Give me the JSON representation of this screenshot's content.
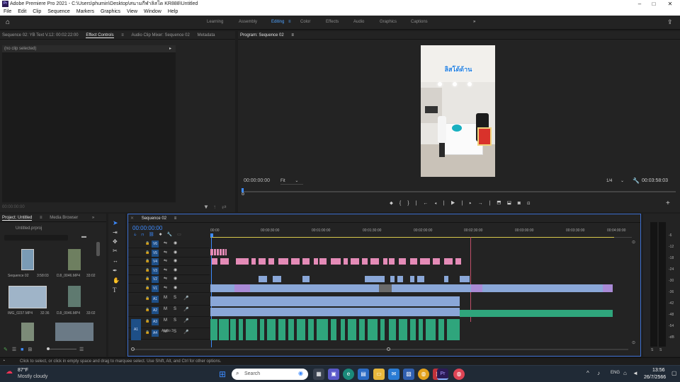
{
  "window": {
    "title": "Adobe Premiere Pro 2021 - C:\\Users\\phumin\\Desktop\\สนามกีฬาลิสโด KR888\\Untitled",
    "logo": "Pr"
  },
  "menu": [
    "File",
    "Edit",
    "Clip",
    "Sequence",
    "Markers",
    "Graphics",
    "View",
    "Window",
    "Help"
  ],
  "workspaces": [
    "Learning",
    "Assembly",
    "Editing",
    "Color",
    "Effects",
    "Audio",
    "Graphics",
    "Captions"
  ],
  "active_workspace": "Editing",
  "source_panel": {
    "tabs": [
      "Sequence 02: YB Text V.12: 00:02:22:00",
      "Effect Controls",
      "Audio Clip Mixer: Sequence 02",
      "Metadata"
    ],
    "active_tab": "Effect Controls",
    "no_clip": "(no clip selected)",
    "timecode": "00:00:00:00"
  },
  "program": {
    "title": "Program: Sequence 02",
    "timecode": "00:00:00:00",
    "fit": "Fit",
    "quality": "1/4",
    "duration": "00:03:58:03",
    "overlay_text": "ลิสโด้ด้าน"
  },
  "project": {
    "tabs": [
      "Project: Untitled",
      "Media Browser"
    ],
    "file": "Untitled.prproj",
    "items": [
      {
        "name": "Sequence 02",
        "dur": "3:58:03"
      },
      {
        "name": "DJI_0046.MP4",
        "dur": "33:02"
      },
      {
        "name": "IMG_0237.MP4",
        "dur": "32:36"
      },
      {
        "name": "DJI_0046.MP4",
        "dur": "33:02"
      }
    ]
  },
  "timeline": {
    "tab": "Sequence 02",
    "timecode": "00:00:00:00",
    "ruler": [
      "00:00",
      "00:00:30:00",
      "00:01:00:00",
      "00:01:30:00",
      "00:02:00:00",
      "00:02:30:00",
      "00:03:00:00",
      "00:03:30:00",
      "00:04:00:00"
    ],
    "video_tracks": [
      "V6",
      "V5",
      "V4",
      "V3",
      "V2",
      "V1"
    ],
    "audio_tracks": [
      "A1",
      "A2",
      "A3",
      "A4"
    ],
    "audio3_name": "Audio 3",
    "a1_source": "A1",
    "mute": "M",
    "solo": "S"
  },
  "meter": {
    "labels": [
      "-6",
      "-12",
      "-18",
      "-24",
      "-30",
      "-36",
      "-42",
      "-48",
      "-54",
      "-dB"
    ],
    "s": "S"
  },
  "status_bar": "Click to select, or click in empty space and drag to marquee select. Use Shift, Alt, and Ctrl for other options.",
  "taskbar": {
    "weather_temp": "87°F",
    "weather_desc": "Mostly cloudy",
    "search_placeholder": "Search",
    "language": "ENG",
    "time": "13:56",
    "date": "26/7/2566"
  }
}
